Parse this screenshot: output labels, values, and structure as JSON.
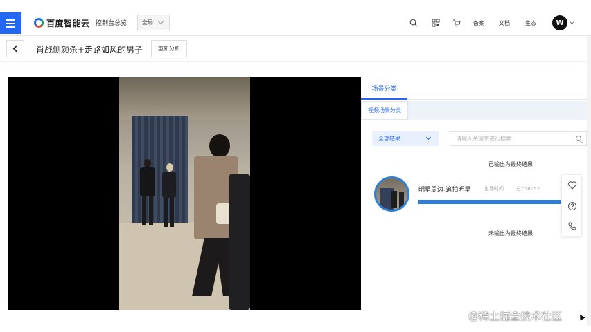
{
  "nav": {
    "brand": "百度智能云",
    "console": "控制台总览",
    "region": "全局",
    "links": [
      "备案",
      "文档",
      "生态"
    ],
    "icons": [
      "search-icon",
      "qrcode-icon",
      "cart-icon"
    ],
    "avatar": "W"
  },
  "header": {
    "title": "肖战侧颜杀+走路如风的男子",
    "reanalyze": "重新分析"
  },
  "panel": {
    "tab": "场景分类",
    "subtab": "视频场景分类",
    "filter": "全部结果",
    "search_placeholder": "请输入关键字进行搜索",
    "output_label": "已输出为最终结果",
    "not_output_label": "未输出为最终结果",
    "result": {
      "title": "明星周边-追拍明星",
      "meta_label": "出场时间",
      "meta_value": "总计00:52",
      "progress": 1.0
    }
  },
  "floating": [
    "heart-icon",
    "help-icon",
    "phone-icon"
  ],
  "watermark": "@稀土掘金技术社区",
  "colors": {
    "accent": "#2468f2",
    "progress": "#2e7fd6"
  }
}
